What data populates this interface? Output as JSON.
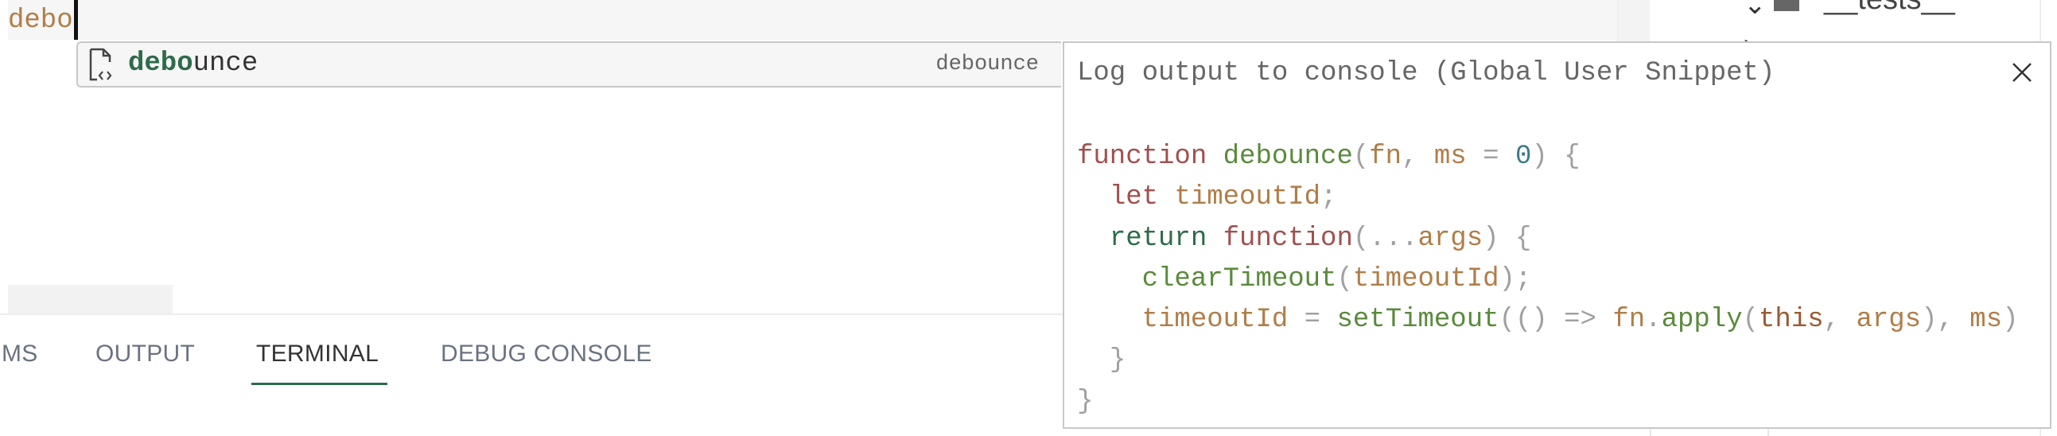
{
  "editor": {
    "typed_text": "debo"
  },
  "suggest": {
    "items": [
      {
        "icon": "snippet-icon",
        "label_match": "debo",
        "label_rest": "unce",
        "detail": "debounce"
      }
    ]
  },
  "details": {
    "title": "Log output to console (Global User Snippet)",
    "close_icon": "close-icon",
    "code_lines": [
      [
        [
          "kw",
          "function"
        ],
        [
          "plain",
          " "
        ],
        [
          "fn",
          "debounce"
        ],
        [
          "punc",
          "("
        ],
        [
          "var",
          "fn"
        ],
        [
          "punc",
          ", "
        ],
        [
          "var",
          "ms"
        ],
        [
          "punc",
          " = "
        ],
        [
          "num",
          "0"
        ],
        [
          "punc",
          ") {"
        ]
      ],
      [
        [
          "plain",
          "  "
        ],
        [
          "kw",
          "let"
        ],
        [
          "plain",
          " "
        ],
        [
          "var",
          "timeoutId"
        ],
        [
          "punc",
          ";"
        ]
      ],
      [
        [
          "plain",
          "  "
        ],
        [
          "ret",
          "return"
        ],
        [
          "plain",
          " "
        ],
        [
          "kw",
          "function"
        ],
        [
          "punc",
          "(..."
        ],
        [
          "var",
          "args"
        ],
        [
          "punc",
          ") {"
        ]
      ],
      [
        [
          "plain",
          "    "
        ],
        [
          "fn",
          "clearTimeout"
        ],
        [
          "punc",
          "("
        ],
        [
          "var",
          "timeoutId"
        ],
        [
          "punc",
          ");"
        ]
      ],
      [
        [
          "plain",
          "    "
        ],
        [
          "var",
          "timeoutId"
        ],
        [
          "punc",
          " = "
        ],
        [
          "fn",
          "setTimeout"
        ],
        [
          "punc",
          "(() => "
        ],
        [
          "var",
          "fn"
        ],
        [
          "punc",
          "."
        ],
        [
          "fn",
          "apply"
        ],
        [
          "punc",
          "("
        ],
        [
          "this",
          "this"
        ],
        [
          "punc",
          ", "
        ],
        [
          "var",
          "args"
        ],
        [
          "punc",
          "), "
        ],
        [
          "var",
          "ms"
        ],
        [
          "punc",
          ")"
        ]
      ],
      [
        [
          "plain",
          "  "
        ],
        [
          "punc",
          "}"
        ]
      ],
      [
        [
          "punc",
          "}"
        ]
      ]
    ]
  },
  "panel": {
    "tabs": [
      {
        "label": "MS",
        "active": false
      },
      {
        "label": "OUTPUT",
        "active": false
      },
      {
        "label": "TERMINAL",
        "active": true
      },
      {
        "label": "DEBUG CONSOLE",
        "active": false
      }
    ]
  },
  "sidebar": {
    "tree": [
      {
        "label": "__tests__",
        "expanded": true,
        "icon": "folder-icon"
      }
    ]
  },
  "colors": {
    "accent": "#2e6b4a",
    "keyword": "#a05050",
    "function": "#5a8a3c",
    "variable": "#b07d48",
    "number": "#3d7a8a",
    "punctuation": "#a0a0a0"
  }
}
